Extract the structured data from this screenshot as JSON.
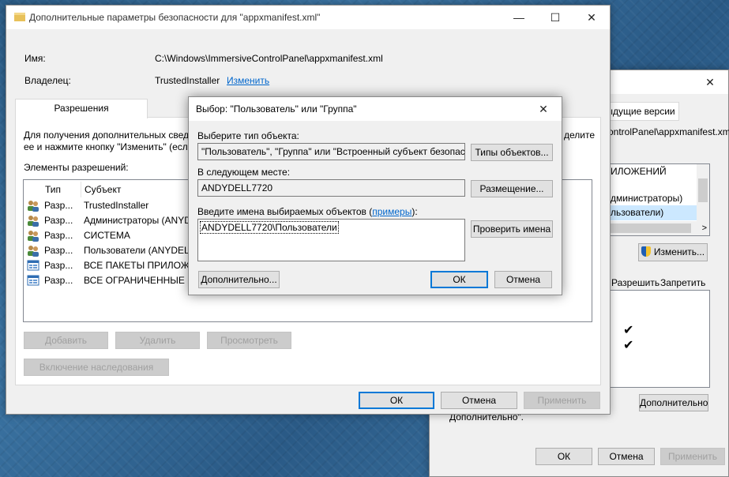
{
  "main_window": {
    "title": "Дополнительные параметры безопасности  для \"appxmanifest.xml\"",
    "name_label": "Имя:",
    "name_value": "C:\\Windows\\ImmersiveControlPanel\\appxmanifest.xml",
    "owner_label": "Владелец:",
    "owner_value": "TrustedInstaller",
    "owner_change_link": "Изменить",
    "tab_permissions": "Разрешения",
    "info_text_1": "Для получения дополнительных свед",
    "info_text_2": "ее и нажмите кнопку \"Изменить\" (есл",
    "info_text_end": "делите",
    "perm_entries_label": "Элементы разрешений:",
    "col_type": "Тип",
    "col_subject": "Субъект",
    "rows": [
      {
        "type": "Разр...",
        "subject": "TrustedInstaller",
        "icon": "user-group-icon"
      },
      {
        "type": "Разр...",
        "subject": "Администраторы (ANYDE",
        "icon": "user-group-icon"
      },
      {
        "type": "Разр...",
        "subject": "СИСТЕМА",
        "icon": "user-group-icon"
      },
      {
        "type": "Разр...",
        "subject": "Пользователи (ANYDEL",
        "icon": "user-group-icon"
      },
      {
        "type": "Разр...",
        "subject": "ВСЕ ПАКЕТЫ ПРИЛОЖЕ",
        "icon": "app-package-icon"
      },
      {
        "type": "Разр...",
        "subject": "ВСЕ ОГРАНИЧЕННЫЕ П",
        "icon": "app-package-icon"
      }
    ],
    "btn_add": "Добавить",
    "btn_remove": "Удалить",
    "btn_view": "Просмотреть",
    "btn_inheritance": "Включение наследования",
    "btn_ok": "ОК",
    "btn_cancel": "Отмена",
    "btn_apply": "Применить"
  },
  "back_window": {
    "tab_prev_versions": "ыдущие версии",
    "path_fragment": "ontrolPanel\\appxmanifest.xm",
    "list_items": [
      "ИЛОЖЕНИЙ",
      "дминистраторы)",
      "льзователи)"
    ],
    "btn_change": "Изменить...",
    "col_allow": "Разрешить",
    "col_deny": "Запретить",
    "check_marks": [
      "✔",
      "✔"
    ],
    "btn_advanced": "Дополнительно",
    "advanced_text": "Дополнительно\".",
    "btn_ok": "ОК",
    "btn_cancel": "Отмена",
    "btn_apply": "Применить"
  },
  "dialog": {
    "title": "Выбор: \"Пользователь\" или \"Группа\"",
    "object_type_label": "Выберите тип объекта:",
    "object_type_value": "\"Пользователь\", \"Группа\" или \"Встроенный субъект безопаснос",
    "btn_object_types": "Типы объектов...",
    "location_label": "В следующем месте:",
    "location_value": "ANDYDELL7720",
    "btn_locations": "Размещение...",
    "names_label_prefix": "Введите имена выбираемых объектов (",
    "names_label_link": "примеры",
    "names_label_suffix": "):",
    "names_value": "ANDYDELL7720\\Пользователи",
    "btn_check_names": "Проверить имена",
    "btn_advanced": "Дополнительно...",
    "btn_ok": "ОК",
    "btn_cancel": "Отмена"
  },
  "colors": {
    "accent": "#0078d7",
    "link": "#0066cc"
  }
}
